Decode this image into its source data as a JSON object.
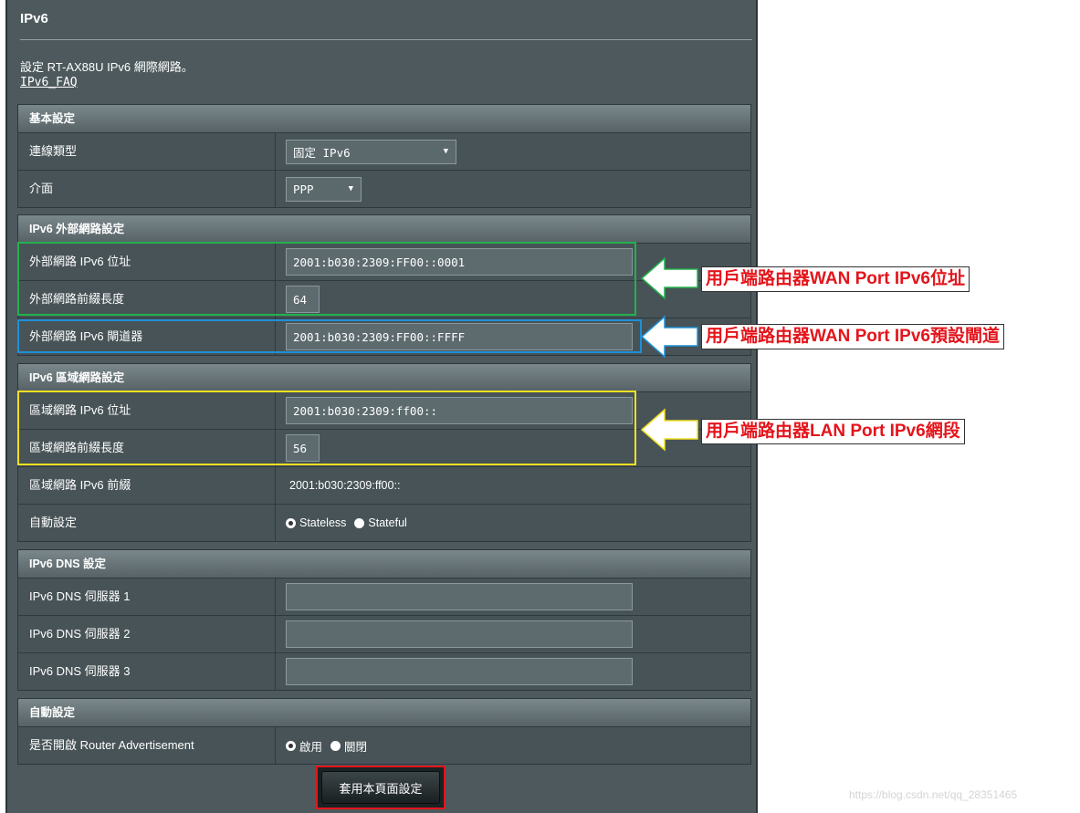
{
  "page": {
    "title": "IPv6",
    "description": "設定 RT-AX88U IPv6 網際網路。",
    "faq_link": "IPv6_FAQ"
  },
  "sections": {
    "basic": {
      "header": "基本設定",
      "connection_type_label": "連線類型",
      "connection_type_value": "固定 IPv6",
      "interface_label": "介面",
      "interface_value": "PPP"
    },
    "wan": {
      "header": "IPv6 外部網路設定",
      "address_label": "外部網路 IPv6 位址",
      "address_value": "2001:b030:2309:FF00::0001",
      "prefix_label": "外部網路前綴長度",
      "prefix_value": "64",
      "gateway_label": "外部網路 IPv6 閘道器",
      "gateway_value": "2001:b030:2309:FF00::FFFF"
    },
    "lan": {
      "header": "IPv6 區域網路設定",
      "address_label": "區域網路 IPv6 位址",
      "address_value": "2001:b030:2309:ff00::",
      "prefix_len_label": "區域網路前綴長度",
      "prefix_len_value": "56",
      "prefix_label": "區域網路 IPv6 前綴",
      "prefix_value": "2001:b030:2309:ff00::",
      "autoconf_label": "自動設定",
      "autoconf_options": [
        "Stateless",
        "Stateful"
      ],
      "autoconf_selected": "Stateless"
    },
    "dns": {
      "header": "IPv6 DNS 設定",
      "server1_label": "IPv6 DNS 伺服器 1",
      "server1_value": "",
      "server2_label": "IPv6 DNS 伺服器 2",
      "server2_value": "",
      "server3_label": "IPv6 DNS 伺服器 3",
      "server3_value": ""
    },
    "auto": {
      "header": "自動設定",
      "ra_label": "是否開啟 Router Advertisement",
      "ra_options": [
        "啟用",
        "關閉"
      ],
      "ra_selected": "啟用"
    }
  },
  "apply_button": "套用本頁面設定",
  "annotations": {
    "wan_address": "用戶端路由器WAN Port IPv6位址",
    "wan_gateway": "用戶端路由器WAN Port IPv6預設閘道",
    "lan_segment": "用戶端路由器LAN Port IPv6網段"
  },
  "colors": {
    "panel_bg": "#4d595d",
    "highlight_green": "#22b14c",
    "highlight_blue": "#1e90d8",
    "highlight_yellow": "#f0e020",
    "annotation_text": "#e4141b"
  },
  "watermark": "https://blog.csdn.net/qq_28351465"
}
